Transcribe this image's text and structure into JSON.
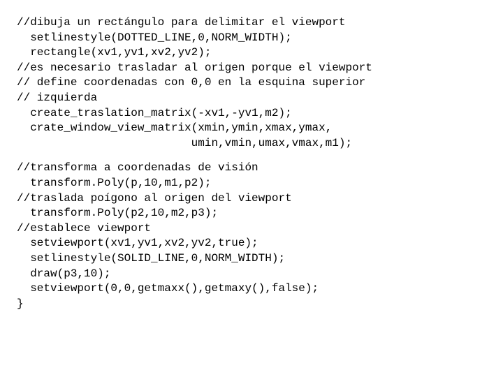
{
  "block1": {
    "l1": "//dibuja un rectángulo para delimitar el viewport",
    "l2": "  setlinestyle(DOTTED_LINE,0,NORM_WIDTH);",
    "l3": "  rectangle(xv1,yv1,xv2,yv2);",
    "l4": "//es necesario trasladar al origen porque el viewport",
    "l5": "// define coordenadas con 0,0 en la esquina superior",
    "l6": "// izquierda",
    "l7": "  create_traslation_matrix(-xv1,-yv1,m2);",
    "l8": "  crate_window_view_matrix(xmin,ymin,xmax,ymax,",
    "l9": "                          umin,vmin,umax,vmax,m1);"
  },
  "block2": {
    "l1": "//transforma a coordenadas de visión",
    "l2": "  transform.Poly(p,10,m1,p2);",
    "l3": "//traslada poígono al origen del viewport",
    "l4": "  transform.Poly(p2,10,m2,p3);",
    "l5": "//establece viewport",
    "l6": "  setviewport(xv1,yv1,xv2,yv2,true);",
    "l7": "  setlinestyle(SOLID_LINE,0,NORM_WIDTH);",
    "l8": "  draw(p3,10);",
    "l9": "  setviewport(0,0,getmaxx(),getmaxy(),false);",
    "l10": "}"
  }
}
